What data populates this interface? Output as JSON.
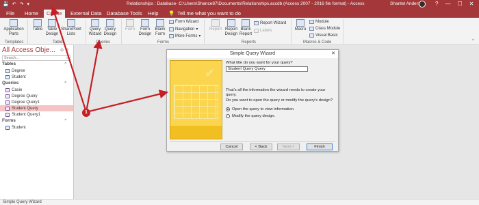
{
  "window": {
    "title": "Relationships : Database- C:\\Users\\Shance87\\Documents\\Relationships.accdb (Access 2007 - 2016 file format) - Access",
    "user": "Shantel Anderson",
    "controls": [
      "?",
      "—",
      "☐",
      "✕"
    ]
  },
  "quick_access": [
    "💾",
    "↶",
    "↷",
    "▾"
  ],
  "tabs": [
    "File",
    "Home",
    "Create",
    "External Data",
    "Database Tools",
    "Help"
  ],
  "tell_me": "Tell me what you want to do",
  "ribbon": {
    "application_parts": "Application Parts",
    "table": "Table",
    "table_design": "Table Design",
    "sharepoint_lists": "SharePoint Lists",
    "query_wizard": "Query Wizard",
    "query_design": "Query Design",
    "form": "Form",
    "form_design": "Form Design",
    "blank_form": "Blank Form",
    "form_wizard": "Form Wizard",
    "navigation": "Navigation",
    "more_forms": "More Forms",
    "report": "Report",
    "report_design": "Report Design",
    "blank_report": "Blank Report",
    "report_wizard": "Report Wizard",
    "labels": "Labels",
    "macro": "Macro",
    "module": "Module",
    "class_module": "Class Module",
    "visual_basic": "Visual Basic",
    "groups": {
      "templates": "Templates",
      "tables": "Tables",
      "queries": "Queries",
      "forms": "Forms",
      "reports": "Reports",
      "macros_code": "Macros & Code"
    }
  },
  "nav": {
    "title": "All Access Obje...",
    "search_placeholder": "Search...",
    "sections": [
      {
        "label": "Tables",
        "items": [
          "Degree",
          "Student"
        ]
      },
      {
        "label": "Queries",
        "items": [
          "Casie",
          "Degree Query",
          "Degree Query1",
          "Student Query",
          "Student Query1"
        ],
        "selected": "Student Query"
      },
      {
        "label": "Forms",
        "items": [
          "Student"
        ]
      }
    ]
  },
  "dialog": {
    "title": "Simple Query Wizard",
    "prompt_title": "What title do you want for your query?",
    "title_value": "Student Query Query",
    "info": "That's all the information the wizard needs to create your query.",
    "question": "Do you want to open the query or modify the query's design?",
    "option_open": "Open the query to view information.",
    "option_modify": "Modify the query design.",
    "selected_option": "open",
    "buttons": {
      "cancel": "Cancel",
      "back": "< Back",
      "next": "Next >",
      "finish": "Finish"
    }
  },
  "annotation": {
    "badge": "1",
    "color": "#c41f24"
  },
  "status_bar": "Simple Query Wizard",
  "colors": {
    "accent": "#a4373a",
    "selected_row": "#f5c4c4",
    "wizard_art": "#fbd54d"
  }
}
